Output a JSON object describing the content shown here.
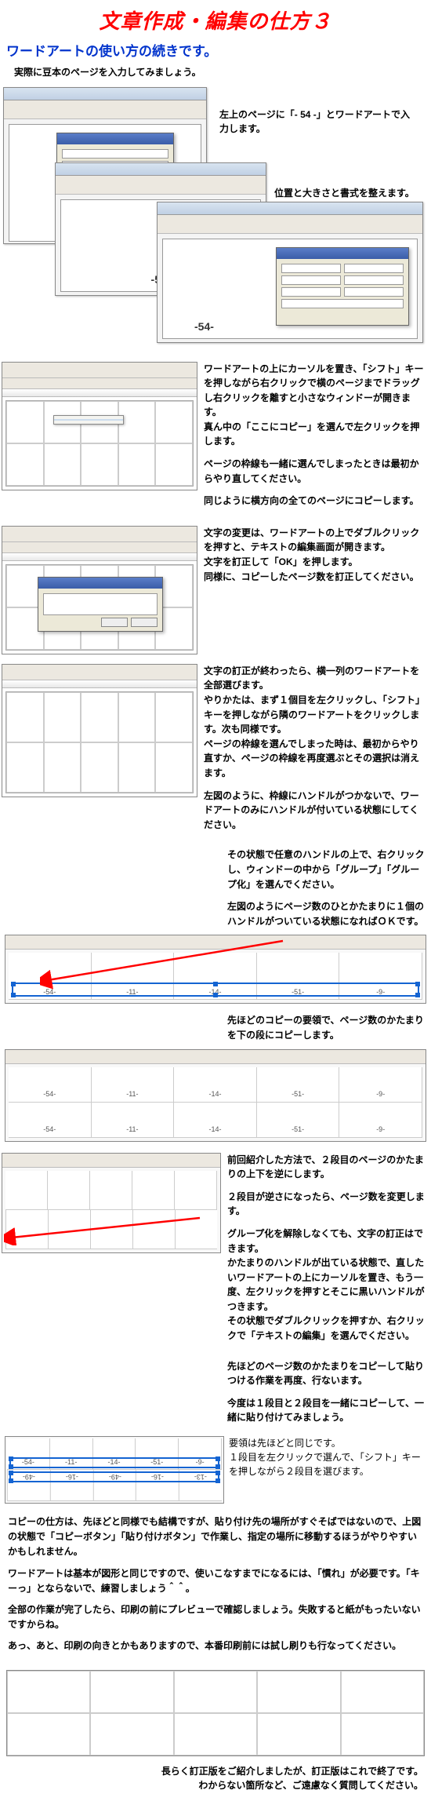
{
  "title": "文章作成・編集の仕方３",
  "subtitle": "ワードアートの使い方の続きです。",
  "intro": "実際に豆本のページを入力してみましょう。",
  "cap1": "左上のページに「- 54 -」とワードアートで入力します。",
  "cap2": "位置と大きさと書式を整えます。",
  "page_label": "-54-",
  "sec3": {
    "p1": "ワードアートの上にカーソルを置き、「シフト」キーを押しながら右クリックで横のページまでドラッグし右クリックを離すと小さなウィンドーが開きます。\n真ん中の「ここにコピー」を選んで左クリックを押します。",
    "p2": "ページの枠線も一緒に選んでしまったときは最初からやり直してください。",
    "p3": "同じように横方向の全てのページにコピーします。"
  },
  "sec4": {
    "p1": "文字の変更は、ワードアートの上でダブルクリックを押すと、テキストの編集画面が開きます。\n文字を訂正して「OK」を押します。\n同様に、コピーしたページ数を訂正してください。"
  },
  "sec5": {
    "p1": "文字の訂正が終わったら、横一列のワードアートを全部選びます。\nやりかたは、まず１個目を左クリックし、「シフト」キーを押しながら隣のワードアートをクリックします。次も同様です。\nページの枠線を選んでしまった時は、最初からやり直すか、ページの枠線を再度選ぶとその選択は消えます。",
    "p2": "左図のように、枠線にハンドルがつかないで、ワードアートのみにハンドルが付いている状態にしてください。"
  },
  "sec6": {
    "p1": "その状態で任意のハンドルの上で、右クリックし、ウィンドーの中から「グループ」「グループ化」を選んでください。",
    "p2": "左図のようにページ数のひとかたまりに１個のハンドルがついている状態になればＯＫです。"
  },
  "sec6_cells": [
    "-54-",
    "-11-",
    "-14-",
    "-51-",
    "-9-"
  ],
  "sec7": {
    "p1": "先ほどのコピーの要領で、ページ数のかたまりを下の段にコピーします。"
  },
  "sec7_row1": [
    "-54-",
    "-11-",
    "-14-",
    "-51-",
    "-9-"
  ],
  "sec7_row2": [
    "-54-",
    "-11-",
    "-14-",
    "-51-",
    "-9-"
  ],
  "sec8": {
    "p1": "前回紹介した方法で、２段目のページのかたまりの上下を逆にします。",
    "p2": "２段目が逆さになったら、ページ数を変更します。",
    "p3": "グループ化を解除しなくても、文字の訂正はできます。\nかたまりのハンドルが出ている状態で、直したいワードアートの上にカーソルを置き、もう一度、左クリックを押すとそこに黒いハンドルがつきます。\nその状態でダブルクリックを押すか、右クリックで「テキストの編集」を選んでください。"
  },
  "sec9": {
    "p1": "先ほどのページ数のかたまりをコピーして貼りつける作業を再度、行ないます。",
    "p2": "今度は１段目と２段目を一緒にコピーして、一緒に貼り付けてみましょう。",
    "p3": "要領は先ほどと同じです。\n１段目を左クリックで選んで、「シフト」キーを押しながら２段目を選びます。"
  },
  "sec9_top": [
    "-54-",
    "-11-",
    "-14-",
    "-51-",
    "-9-"
  ],
  "sec9_bot": [
    "-49-",
    "-16-",
    "-49-",
    "-16-",
    "-13-"
  ],
  "footer": {
    "f1": "コピーの仕方は、先ほどと同様でも結構ですが、貼り付け先の場所がすぐそばではないので、上図の状態で「コピーボタン」「貼り付けボタン」で作業し、指定の場所に移動するほうがやりやすいかもしれません。",
    "f2": "ワードアートは基本が図形と同じですので、使いこなすまでになるには、「慣れ」が必要です。「キーっ」とならないで、練習しましょう＾＾。",
    "f3": "全部の作業が完了したら、印刷の前にプレビューで確認しましょう。失敗すると紙がもったいないですからね。",
    "f4": "あっ、あと、印刷の向きとかもありますので、本番印刷前には試し刷りも行なってください。"
  },
  "final_caption": "長らく訂正版をご紹介しましたが、訂正版はこれで終了です。\nわからない箇所など、ご遠慮なく質問してください。"
}
